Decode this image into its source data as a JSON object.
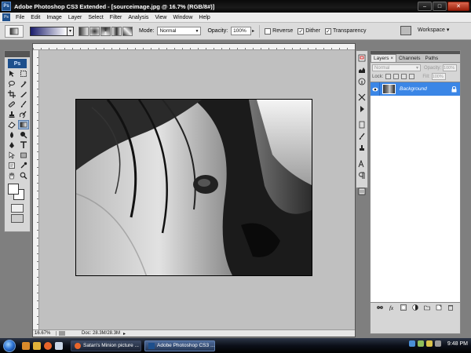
{
  "window": {
    "title": "Adobe Photoshop CS3 Extended - [sourceimage.jpg @ 16.7% (RGB/8#)]",
    "app_badge": "Ps",
    "controls": {
      "minimize": "–",
      "maximize": "□",
      "close": "✕"
    }
  },
  "menu": {
    "badge": "Ps",
    "items": [
      "File",
      "Edit",
      "Image",
      "Layer",
      "Select",
      "Filter",
      "Analysis",
      "View",
      "Window",
      "Help"
    ]
  },
  "options": {
    "mode_label": "Mode:",
    "mode_value": "Normal",
    "opacity_label": "Opacity:",
    "opacity_value": "100%",
    "reverse_label": "Reverse",
    "reverse_checked": "",
    "dither_label": "Dither",
    "dither_checked": "✓",
    "transparency_label": "Transparency",
    "transparency_checked": "✓",
    "workspace_label": "Workspace ▾",
    "gradient_colors": [
      "#1a1c6b",
      "#ffffff"
    ]
  },
  "tools": {
    "logo": "Ps",
    "items": [
      "move-tool-icon",
      "marquee-tool-icon",
      "lasso-tool-icon",
      "magic-wand-tool-icon",
      "crop-tool-icon",
      "slice-tool-icon",
      "healing-brush-icon",
      "brush-tool-icon",
      "clone-stamp-icon",
      "history-brush-icon",
      "eraser-tool-icon",
      "gradient-tool-icon",
      "blur-tool-icon",
      "dodge-tool-icon",
      "pen-tool-icon",
      "type-tool-icon",
      "path-selection-icon",
      "shape-tool-icon",
      "notes-tool-icon",
      "eyedropper-tool-icon",
      "hand-tool-icon",
      "zoom-tool-icon"
    ],
    "foreground_color": "#ffffff",
    "background_color": "#ffffff"
  },
  "document": {
    "zoom": "16.67%",
    "doc_size": "Doc: 28.3M/28.3M",
    "canvas_bg": "#c0c0c0"
  },
  "layers_panel": {
    "tabs": [
      {
        "label": "Layers",
        "close": "×"
      },
      {
        "label": "Channels"
      },
      {
        "label": "Paths"
      }
    ],
    "blend_mode": "Normal",
    "opacity_label": "Opacity:",
    "opacity_value": "100%",
    "lock_label": "Lock:",
    "fill_label": "Fill:",
    "fill_value": "100%",
    "layers": [
      {
        "name": "Background",
        "selected": true
      }
    ],
    "selection_color": "#3b86e6"
  },
  "taskbar": {
    "buttons": [
      {
        "label": "Satan's Minion picture ...",
        "active": false
      },
      {
        "label": "Adobe Photoshop CS3 ...",
        "active": true
      }
    ],
    "clock": "9:48 PM"
  }
}
